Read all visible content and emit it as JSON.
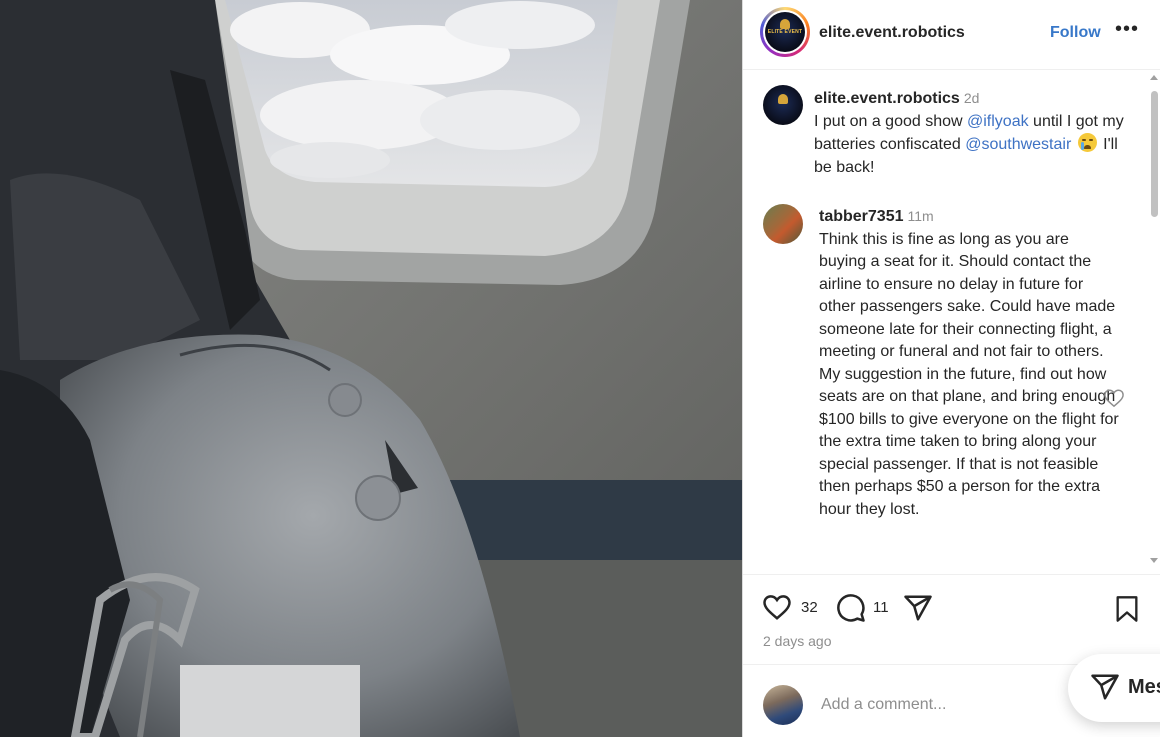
{
  "post": {
    "username": "elite.event.robotics",
    "follow_label": "Follow",
    "more_label": "•••",
    "logo_text": "ELITE EVENT"
  },
  "caption": {
    "username": "elite.event.robotics",
    "time": "2d",
    "text_1": "I put on a good show ",
    "mention_1": "@iflyoak",
    "text_2": " until I got my batteries confiscated ",
    "mention_2": "@southwestair",
    "text_3": " I'll be back!"
  },
  "comment": {
    "username": "tabber7351",
    "time": "11m",
    "text": "Think this is fine as long as you are buying a seat for it. Should contact the airline to ensure no delay in future for other passengers sake. Could have made someone late for their connecting flight, a meeting or funeral and not fair to others. My suggestion in the future, find out how seats are on that plane, and bring enough $100 bills to give everyone on the flight for the extra time taken to bring along your special passenger. If that is not feasible then perhaps $50 a person for the extra hour they lost."
  },
  "actions": {
    "likes": "32",
    "comments": "11",
    "posted_ago": "2 days ago"
  },
  "add_comment": {
    "placeholder": "Add a comment..."
  },
  "messages": {
    "label": "Mes"
  },
  "icons": {
    "more": "more-icon",
    "like": "heart-icon",
    "comment": "comment-icon",
    "share": "share-icon",
    "save": "bookmark-icon",
    "comment_like": "heart-icon",
    "messages": "send-icon"
  }
}
